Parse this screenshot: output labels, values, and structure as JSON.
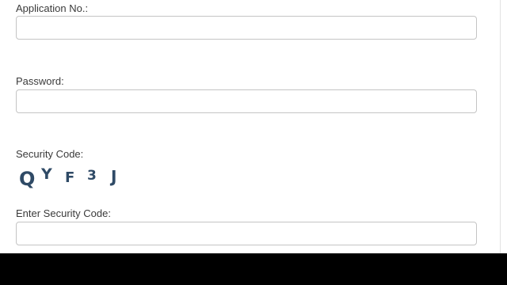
{
  "form": {
    "application_no": {
      "label": "Application No.:",
      "value": ""
    },
    "password": {
      "label": "Password:",
      "value": ""
    },
    "security_code": {
      "label": "Security Code:",
      "captcha_chars": [
        "Q",
        "Y",
        "F",
        "3",
        "J"
      ]
    },
    "enter_security_code": {
      "label": "Enter Security Code:",
      "value": ""
    }
  },
  "colors": {
    "label_text": "#3a3a3a",
    "field_border": "#c4c4c4",
    "captcha_text": "#2f4a66",
    "bottom_bar": "#000000"
  }
}
